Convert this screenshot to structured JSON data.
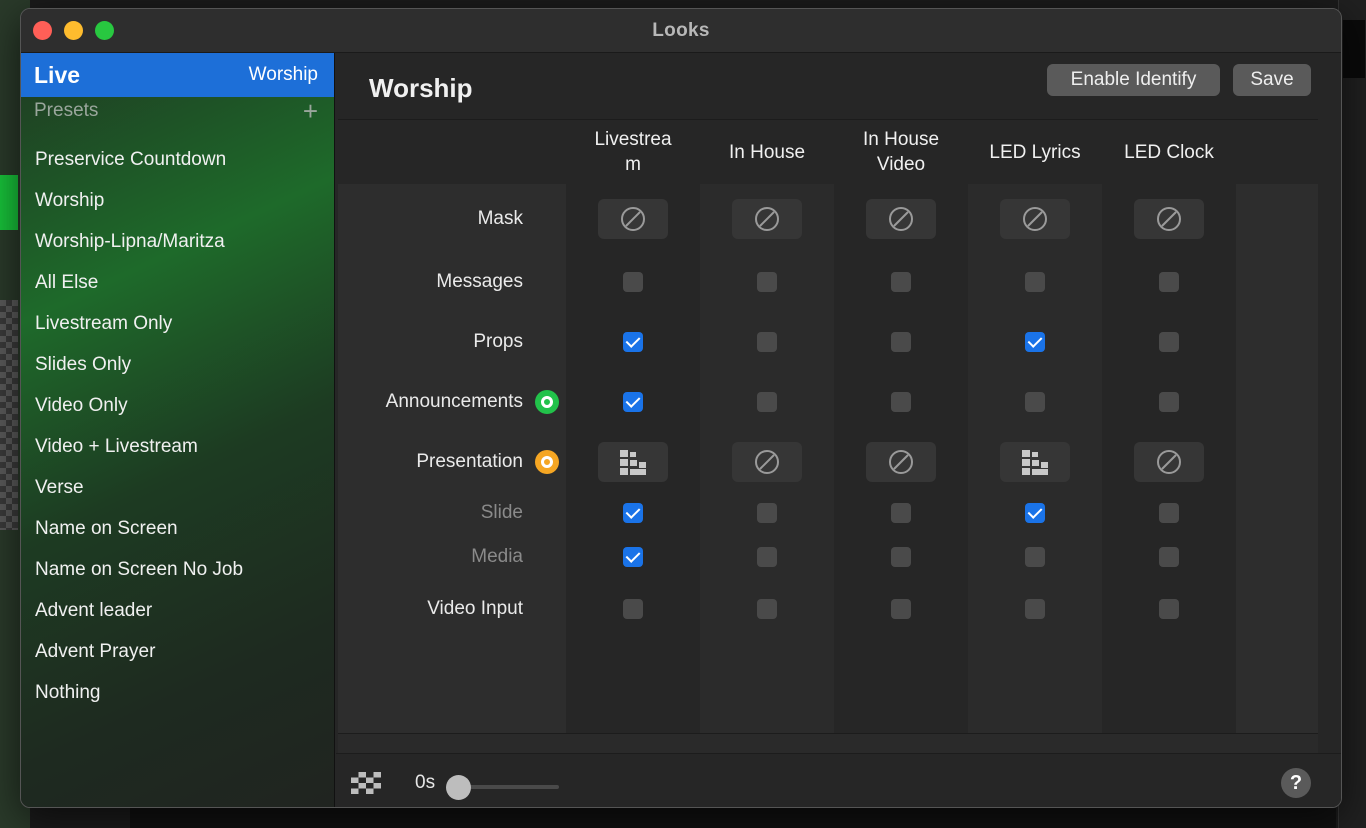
{
  "window": {
    "title": "Looks"
  },
  "sidebar": {
    "live_label": "Live",
    "live_value": "Worship",
    "presets_label": "Presets",
    "presets": [
      "Preservice Countdown",
      "Worship",
      "Worship-Lipna/Maritza",
      "All Else",
      "Livestream Only",
      "Slides Only",
      "Video Only",
      "Video + Livestream",
      "Verse",
      "Name on Screen",
      "Name on Screen No Job",
      "Advent leader",
      "Advent Prayer",
      "Nothing"
    ]
  },
  "main": {
    "title": "Worship",
    "enable_identify_label": "Enable Identify",
    "save_label": "Save",
    "columns": [
      "Livestrea m",
      "In House",
      "In House Video",
      "LED Lyrics",
      "LED Clock"
    ],
    "rows": [
      {
        "label": "Mask",
        "type": "icon",
        "cells": [
          "none",
          "none",
          "none",
          "none",
          "none"
        ]
      },
      {
        "label": "Messages",
        "type": "checkbox",
        "cells": [
          false,
          false,
          false,
          false,
          false
        ]
      },
      {
        "label": "Props",
        "type": "checkbox",
        "cells": [
          true,
          false,
          false,
          true,
          false
        ]
      },
      {
        "label": "Announcements",
        "type": "checkbox",
        "status": "green",
        "cells": [
          true,
          false,
          false,
          false,
          false
        ]
      },
      {
        "label": "Presentation",
        "type": "icon",
        "status": "orange",
        "cells": [
          "layers",
          "none",
          "none",
          "layers",
          "none"
        ]
      },
      {
        "label": "Slide",
        "type": "checkbox",
        "sub": true,
        "cells": [
          true,
          false,
          false,
          true,
          false
        ]
      },
      {
        "label": "Media",
        "type": "checkbox",
        "sub": true,
        "cells": [
          true,
          false,
          false,
          false,
          false
        ]
      },
      {
        "label": "Video Input",
        "type": "checkbox",
        "cells": [
          false,
          false,
          false,
          false,
          false
        ]
      }
    ]
  },
  "footer": {
    "transition_time": "0s",
    "help_label": "?"
  },
  "colors": {
    "accent": "#1d6fd8",
    "checkbox_on": "#1a73e8",
    "status_green": "#22c24a",
    "status_orange": "#f5a623"
  },
  "icons": {
    "mask_none": "prohibited-icon",
    "presentation": "layers-icon",
    "transition": "checkerboard-icon"
  }
}
